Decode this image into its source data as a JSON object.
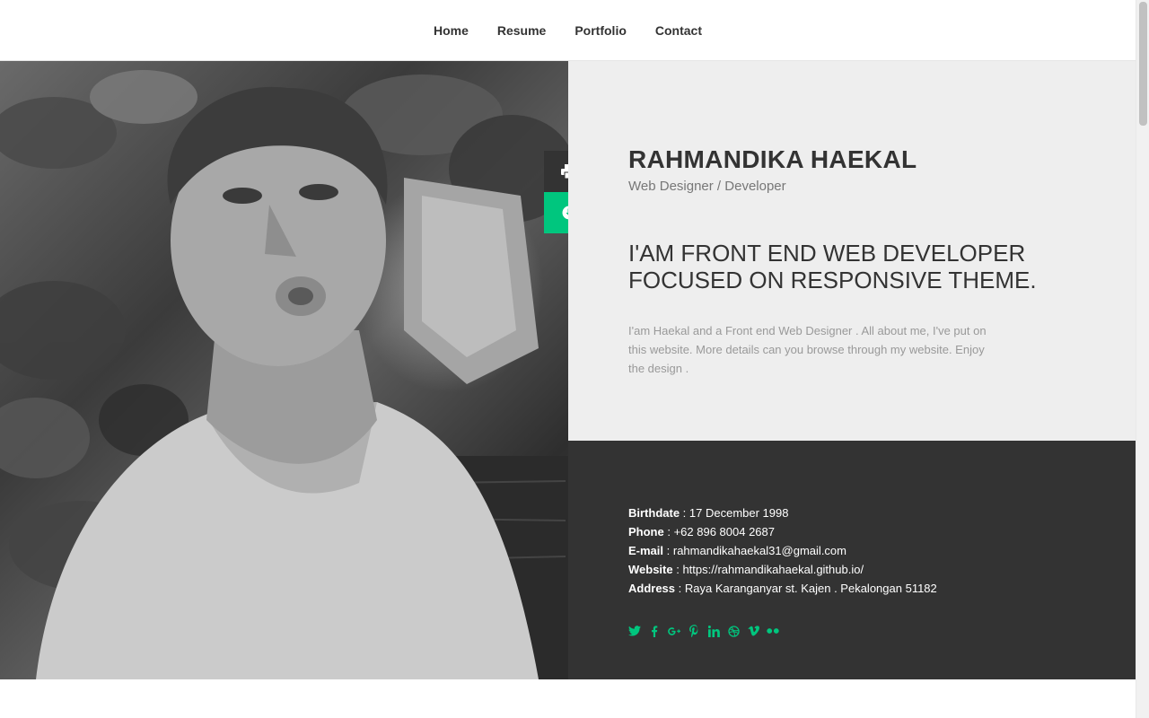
{
  "nav": {
    "items": [
      {
        "label": "Home"
      },
      {
        "label": "Resume"
      },
      {
        "label": "Portfolio"
      },
      {
        "label": "Contact"
      }
    ]
  },
  "colors": {
    "accent": "#00c67e",
    "dark": "#333333",
    "light_panel": "#eeeeee"
  },
  "side_actions": {
    "print_icon": "print-icon",
    "download_icon": "download-circle-icon"
  },
  "profile": {
    "name": "RAHMANDIKA HAEKAL",
    "role": "Web Designer / Developer",
    "headline_line1": "I'AM FRONT END WEB DEVELOPER",
    "headline_line2": "FOCUSED ON RESPONSIVE THEME.",
    "bio": "I'am Haekal and a Front end Web Designer . All about me, I've put on this website. More details can you browse through my website. Enjoy the design ."
  },
  "details": {
    "birthdate_label": "Birthdate",
    "birthdate_value": "17 December 1998",
    "phone_label": "Phone",
    "phone_value": "+62 896 8004 2687",
    "email_label": "E-mail",
    "email_value": "rahmandikahaekal31@gmail.com",
    "website_label": "Website",
    "website_value": "https://rahmandikahaekal.github.io/",
    "address_label": "Address",
    "address_value": "Raya Karanganyar st. Kajen . Pekalongan 51182"
  },
  "socials": [
    {
      "icon": "twitter-icon"
    },
    {
      "icon": "facebook-icon"
    },
    {
      "icon": "google-plus-icon"
    },
    {
      "icon": "pinterest-icon"
    },
    {
      "icon": "linkedin-icon"
    },
    {
      "icon": "dribbble-icon"
    },
    {
      "icon": "vimeo-icon"
    },
    {
      "icon": "flickr-icon"
    }
  ]
}
